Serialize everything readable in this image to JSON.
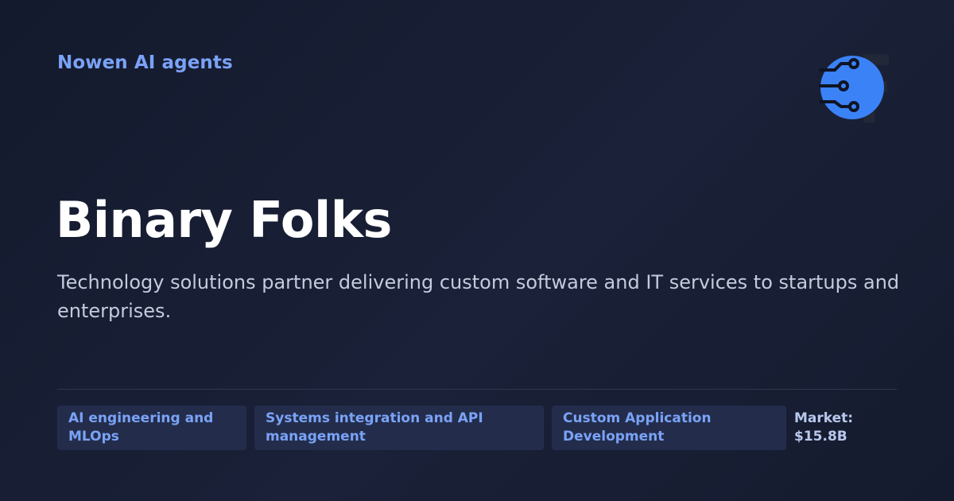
{
  "header": {
    "brand": "Nowen AI agents",
    "logo_icon": "binary-folks-logo-icon"
  },
  "company": {
    "name": "Binary Folks",
    "description": "Technology solutions partner delivering custom software and IT services to startups and enterprises."
  },
  "tags": [
    {
      "label": "AI engineering and MLOps"
    },
    {
      "label": "Systems integration and API management"
    },
    {
      "label": "Custom Application Development"
    }
  ],
  "market": {
    "label": "Market:",
    "value": "$15.8B"
  },
  "colors": {
    "accent": "#7aa2f7",
    "background": "#161c30",
    "tag_background": "#232d4b",
    "logo_blue": "#3b82f6"
  }
}
